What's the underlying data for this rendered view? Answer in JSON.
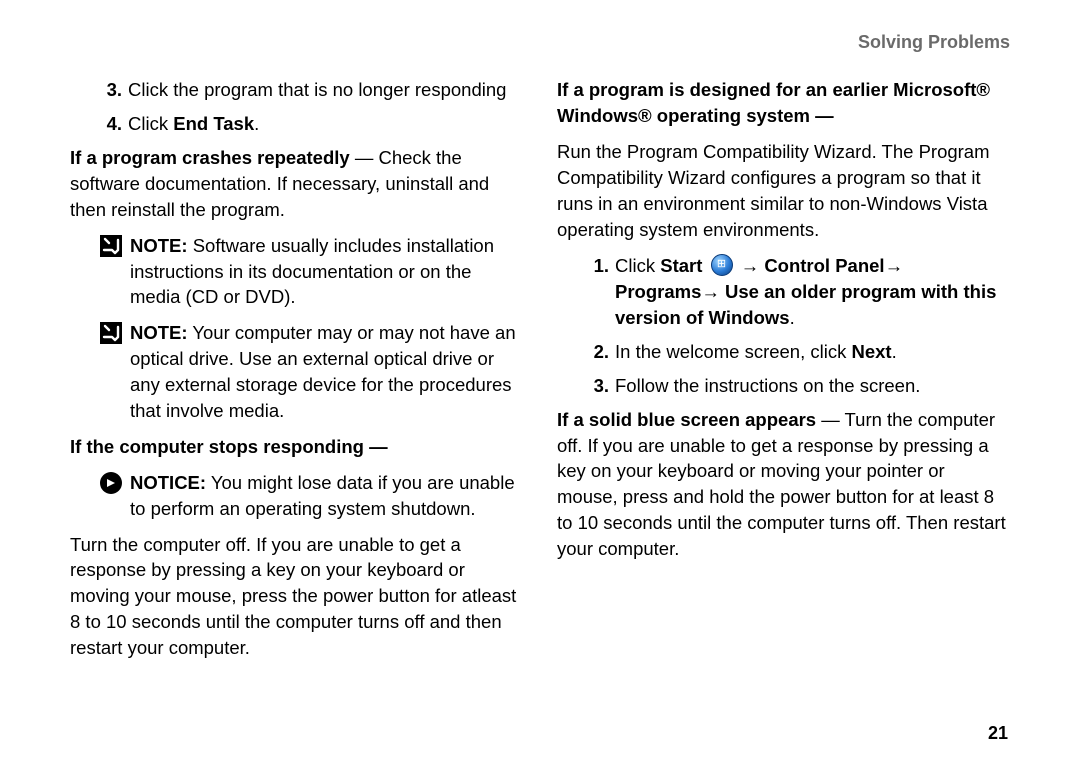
{
  "header": {
    "title": "Solving Problems"
  },
  "pagenum": "21",
  "left": {
    "step3": {
      "num": "3.",
      "text": "Click the program that is no longer responding"
    },
    "step4": {
      "num": "4.",
      "pre": "Click ",
      "bold": "End Task",
      "post": "."
    },
    "crashes": {
      "bold": "If a program crashes repeatedly",
      "rest": " — Check the software documentation. If necessary, uninstall and then reinstall the program."
    },
    "note1": {
      "label": "NOTE:",
      "text": " Software usually includes installation instructions in its documentation or on the media (CD or DVD)."
    },
    "note2": {
      "label": "NOTE:",
      "text": " Your computer may or may not have an optical drive. Use an external optical drive or any external storage device for the procedures that involve media."
    },
    "stops": {
      "bold": "If the computer stops responding —"
    },
    "notice": {
      "label": "NOTICE:",
      "text": " You might lose data if you are unable to perform an operating system shutdown."
    },
    "turnoff": "Turn the computer off. If you are unable to get a response by pressing a key on your keyboard or moving your mouse, press the power button for atleast 8 to 10 seconds until the computer turns off and then restart your computer."
  },
  "right": {
    "earlier_bold": "If a program is designed for an earlier Microsoft® Windows® operating system —",
    "wizard": "Run the Program Compatibility Wizard. The Program Compatibility Wizard configures a program so that it runs in an environment similar to non-Windows Vista operating system environments.",
    "r1": {
      "num": "1.",
      "pre": "Click ",
      "start": "Start",
      "arrow1": " → ",
      "cp": "Control Panel",
      "arrow2": "→ ",
      "prog": "Programs",
      "arrow3": "→ ",
      "use": "Use an older program with this version of Windows",
      "post": "."
    },
    "r2": {
      "num": "2.",
      "pre": "In the welcome screen, click ",
      "bold": "Next",
      "post": "."
    },
    "r3": {
      "num": "3.",
      "text": "Follow the instructions on the screen."
    },
    "blue": {
      "bold": "If a solid blue screen appears",
      "rest": " — Turn the computer off. If you are unable to get a response by pressing a key on your keyboard or moving your pointer or mouse, press and hold the power button for at least 8 to 10 seconds until the computer turns off. Then restart your computer."
    }
  }
}
